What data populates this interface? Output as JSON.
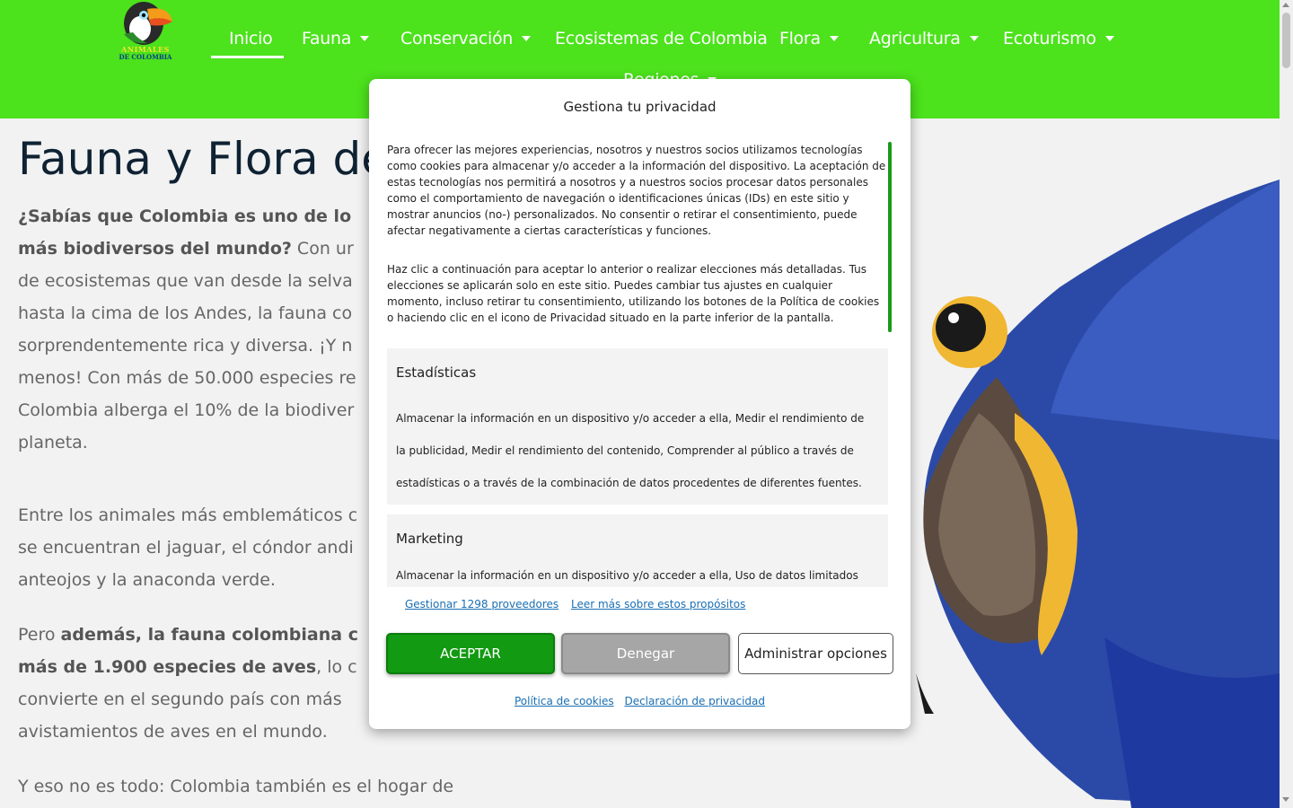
{
  "logo": {
    "line1": "ANIMALES",
    "line2": "DE COLOMBIA"
  },
  "nav": {
    "items": [
      {
        "label": "Inicio"
      },
      {
        "label": "Fauna"
      },
      {
        "label": "Conservación"
      },
      {
        "label": "Ecosistemas de Colombia"
      },
      {
        "label": "Flora"
      },
      {
        "label": "Agricultura"
      },
      {
        "label": "Ecoturismo"
      },
      {
        "label": "Regiones"
      }
    ]
  },
  "content": {
    "title": "Fauna y Flora de",
    "p1_bold": "¿Sabías que Colombia es uno de lo",
    "p1_bold2": "más biodiversos del mundo?",
    "p1_text": " Con ur",
    "p1_lines": [
      "de ecosistemas que van desde la selva",
      "hasta la cima de los Andes, la fauna co",
      "sorprendentemente rica y diversa. ¡Y n",
      "menos! Con más de 50.000 especies re",
      "Colombia alberga el 10% de la biodiver",
      "planeta."
    ],
    "p2_lines": [
      "Entre los animales más emblemáticos c",
      "se encuentran el jaguar, el cóndor andi",
      "anteojos y la anaconda verde."
    ],
    "p3_pre": "Pero ",
    "p3_bold": "además, la fauna colombiana c",
    "p3_bold2": "más de 1.900 especies de aves",
    "p3_text": ", lo c",
    "p3_lines": [
      "convierte en el segundo país con más",
      "avistamientos de aves en el mundo."
    ],
    "p4": "Y eso no es todo: Colombia también es el hogar de"
  },
  "consent": {
    "title": "Gestiona tu privacidad",
    "text1": "Para ofrecer las mejores experiencias, nosotros y nuestros socios utilizamos tecnologías como cookies para almacenar y/o acceder a la información del dispositivo. La aceptación de estas tecnologías nos permitirá a nosotros y a nuestros socios procesar datos personales como el comportamiento de navegación o identificaciones únicas (IDs) en este sitio y mostrar anuncios (no-) personalizados. No consentir o retirar el consentimiento, puede afectar negativamente a ciertas características y funciones.",
    "text2": "Haz clic a continuación para aceptar lo anterior o realizar elecciones más detalladas. Tus elecciones se aplicarán solo en este sitio. Puedes cambiar tus ajustes en cualquier momento, incluso retirar tu consentimiento, utilizando los botones de la Política de cookies o haciendo clic en el icono de Privacidad situado en la parte inferior de la pantalla.",
    "categories": [
      {
        "title": "Estadísticas",
        "description": "Almacenar la información en un dispositivo y/o acceder a ella, Medir el rendimiento de la publicidad, Medir el rendimiento del contenido, Comprender al público a través de estadísticas o a través de la combinación de datos procedentes de diferentes fuentes."
      },
      {
        "title": "Marketing",
        "description": "Almacenar la información en un dispositivo y/o acceder a ella, Uso de datos limitados"
      }
    ],
    "link_vendors": "Gestionar 1298 proveedores",
    "link_purposes": "Leer más sobre estos propósitos",
    "btn_accept": "ACEPTAR",
    "btn_deny": "Denegar",
    "btn_manage": "Administrar opciones",
    "link_cookie_policy": "Política de cookies",
    "link_privacy": "Declaración de privacidad"
  },
  "colors": {
    "header_bg": "#4ce21c",
    "accept_bg": "#129a12",
    "deny_bg": "#a6a6a6",
    "link": "#1a6fb3"
  },
  "icons": [
    "toucan-logo",
    "caret-down-icon",
    "parrot-image"
  ]
}
